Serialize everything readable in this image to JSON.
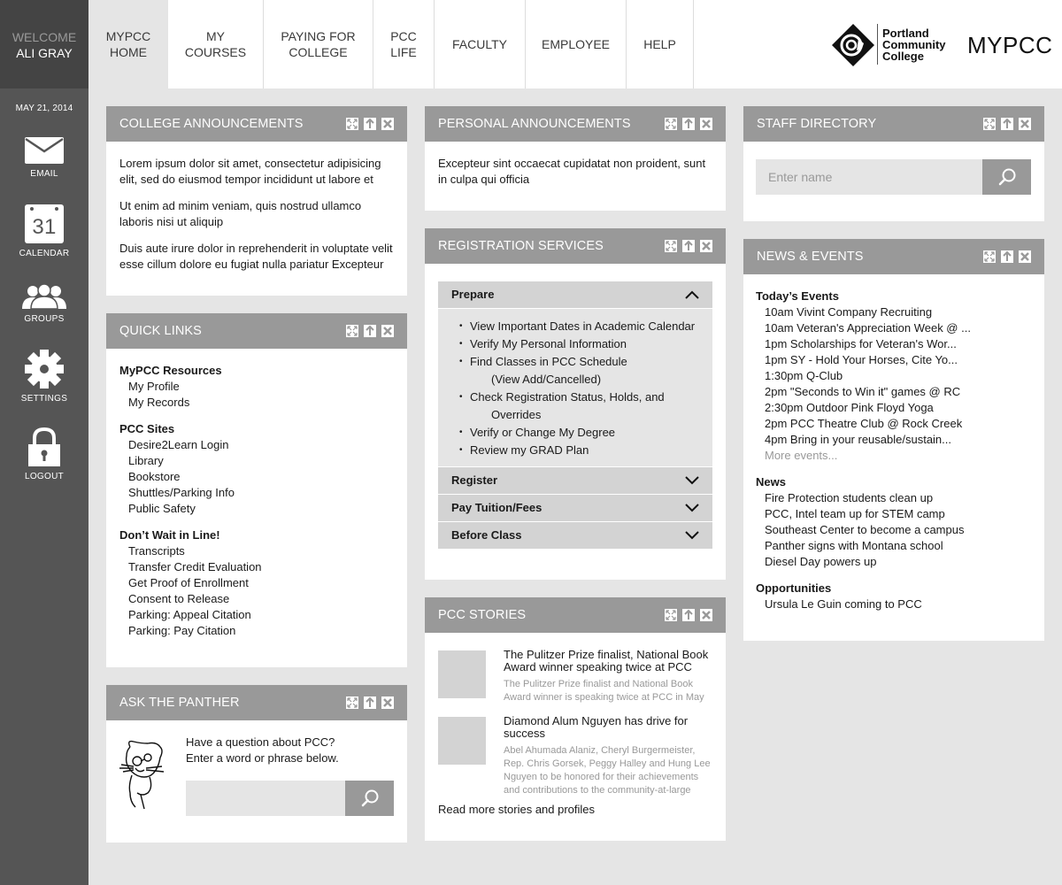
{
  "sidebar": {
    "welcome_label": "WELCOME",
    "user_name": "ALI GRAY",
    "date": "MAY 21, 2014",
    "items": [
      {
        "label": "EMAIL",
        "icon": "envelope-icon"
      },
      {
        "label": "CALENDAR",
        "icon": "calendar-icon",
        "icon_text": "31"
      },
      {
        "label": "GROUPS",
        "icon": "group-icon"
      },
      {
        "label": "SETTINGS",
        "icon": "gear-icon"
      },
      {
        "label": "LOGOUT",
        "icon": "lock-icon"
      }
    ]
  },
  "nav": {
    "tabs": [
      {
        "line1": "MYPCC",
        "line2": "HOME",
        "active": true
      },
      {
        "line1": "MY",
        "line2": "COURSES"
      },
      {
        "line1": "PAYING FOR",
        "line2": "COLLEGE"
      },
      {
        "line1": "PCC",
        "line2": "LIFE"
      },
      {
        "line1": "FACULTY",
        "line2": ""
      },
      {
        "line1": "EMPLOYEE",
        "line2": ""
      },
      {
        "line1": "HELP",
        "line2": ""
      }
    ],
    "logo_lines": [
      "Portland",
      "Community",
      "College"
    ],
    "brand": "MYPCC"
  },
  "panels": {
    "college_announcements": {
      "title": "COLLEGE ANNOUNCEMENTS",
      "paragraphs": [
        "Lorem ipsum dolor sit amet, consectetur adipisicing elit, sed do eiusmod tempor incididunt ut labore et",
        "Ut enim ad minim veniam, quis nostrud ullamco laboris nisi ut aliquip",
        "Duis aute irure dolor in reprehenderit in voluptate velit esse cillum dolore eu fugiat nulla pariatur Excepteur"
      ]
    },
    "quick_links": {
      "title": "QUICK LINKS",
      "groups": [
        {
          "title": "MyPCC Resources",
          "links": [
            "My Profile",
            "My Records"
          ]
        },
        {
          "title": "PCC Sites",
          "links": [
            "Desire2Learn Login",
            "Library",
            "Bookstore",
            "Shuttles/Parking Info",
            "Public Safety"
          ]
        },
        {
          "title": "Don’t Wait in Line!",
          "links": [
            "Transcripts",
            "Transfer Credit Evaluation",
            "Get Proof of Enrollment",
            "Consent to Release",
            "Parking: Appeal Citation",
            "Parking: Pay Citation"
          ]
        }
      ]
    },
    "ask_panther": {
      "title": "ASK THE PANTHER",
      "line1": "Have a question about PCC?",
      "line2": "Enter a word or phrase below.",
      "input_value": "",
      "input_placeholder": ""
    },
    "personal_announcements": {
      "title": "PERSONAL ANNOUNCEMENTS",
      "paragraphs": [
        "Excepteur sint occaecat cupidatat non proident, sunt in culpa qui officia"
      ]
    },
    "registration": {
      "title": "REGISTRATION SERVICES",
      "sections": [
        {
          "label": "Prepare",
          "expanded": true,
          "items": [
            {
              "text": "View Important Dates in Academic Calendar",
              "sub": ""
            },
            {
              "text": "Verify My Personal Information",
              "sub": ""
            },
            {
              "text": "Find Classes in PCC Schedule",
              "sub": "(View Add/Cancelled)"
            },
            {
              "text": "Check Registration Status, Holds, and",
              "sub": "Overrides"
            },
            {
              "text": "Verify or Change My Degree",
              "sub": ""
            },
            {
              "text": "Review my GRAD Plan",
              "sub": ""
            }
          ]
        },
        {
          "label": "Register",
          "expanded": false
        },
        {
          "label": "Pay Tuition/Fees",
          "expanded": false
        },
        {
          "label": "Before Class",
          "expanded": false
        }
      ]
    },
    "stories": {
      "title": "PCC STORIES",
      "items": [
        {
          "title": "The Pulitzer Prize finalist, National Book Award winner speaking twice at PCC",
          "desc": "The Pulitzer Prize finalist and National Book Award winner is speaking twice at PCC in May"
        },
        {
          "title": "Diamond Alum Nguyen has drive for success",
          "desc": "Abel Ahumada Alaniz, Cheryl Burgermeister, Rep. Chris Gorsek, Peggy Halley and Hung Lee Nguyen to be honored for their achievements and contributions to the community-at-large"
        }
      ],
      "read_more": "Read more stories and profiles"
    },
    "staff_directory": {
      "title": "STAFF DIRECTORY",
      "input_placeholder": "Enter name",
      "input_value": ""
    },
    "news_events": {
      "title": "NEWS & EVENTS",
      "groups": [
        {
          "title": "Today’s Events",
          "items": [
            "10am Vivint Company Recruiting",
            "10am Veteran's Appreciation Week @ ...",
            "1pm Scholarships for Veteran's Wor...",
            "1pm SY - Hold Your Horses, Cite Yo...",
            "1:30pm Q-Club",
            "2pm \"Seconds to Win it\" games @ RC",
            "2:30pm Outdoor Pink Floyd Yoga",
            "2pm PCC Theatre Club @ Rock Creek",
            "4pm Bring in your reusable/sustain..."
          ],
          "more": "More events..."
        },
        {
          "title": "News",
          "items": [
            "Fire Protection students clean up",
            "PCC, Intel team up for STEM camp",
            "Southeast Center to become a campus",
            "Panther signs with Montana school",
            "Diesel Day powers up"
          ]
        },
        {
          "title": "Opportunities",
          "items": [
            "Ursula Le Guin coming to PCC"
          ]
        }
      ]
    }
  },
  "colors": {
    "sidebar_bg": "#555555",
    "welcome_bg": "#444444",
    "panel_header": "#999999",
    "page_bg": "#e5e5e5",
    "accordion_header": "#d3d3d3"
  }
}
